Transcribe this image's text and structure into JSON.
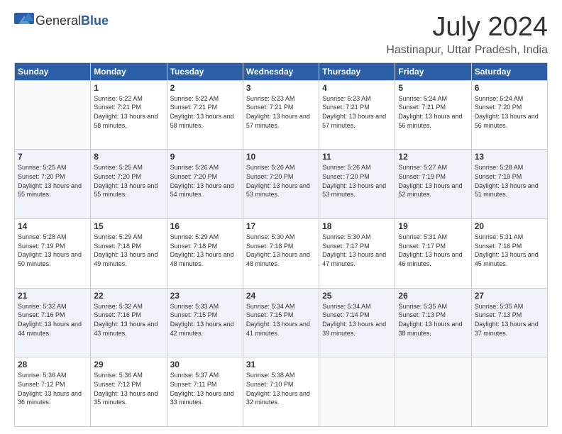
{
  "header": {
    "logo_general": "General",
    "logo_blue": "Blue",
    "title": "July 2024",
    "subtitle": "Hastinapur, Uttar Pradesh, India"
  },
  "calendar": {
    "days_of_week": [
      "Sunday",
      "Monday",
      "Tuesday",
      "Wednesday",
      "Thursday",
      "Friday",
      "Saturday"
    ],
    "weeks": [
      [
        {
          "day": "",
          "sunrise": "",
          "sunset": "",
          "daylight": "",
          "empty": true
        },
        {
          "day": "1",
          "sunrise": "Sunrise: 5:22 AM",
          "sunset": "Sunset: 7:21 PM",
          "daylight": "Daylight: 13 hours and 58 minutes."
        },
        {
          "day": "2",
          "sunrise": "Sunrise: 5:22 AM",
          "sunset": "Sunset: 7:21 PM",
          "daylight": "Daylight: 13 hours and 58 minutes."
        },
        {
          "day": "3",
          "sunrise": "Sunrise: 5:23 AM",
          "sunset": "Sunset: 7:21 PM",
          "daylight": "Daylight: 13 hours and 57 minutes."
        },
        {
          "day": "4",
          "sunrise": "Sunrise: 5:23 AM",
          "sunset": "Sunset: 7:21 PM",
          "daylight": "Daylight: 13 hours and 57 minutes."
        },
        {
          "day": "5",
          "sunrise": "Sunrise: 5:24 AM",
          "sunset": "Sunset: 7:21 PM",
          "daylight": "Daylight: 13 hours and 56 minutes."
        },
        {
          "day": "6",
          "sunrise": "Sunrise: 5:24 AM",
          "sunset": "Sunset: 7:20 PM",
          "daylight": "Daylight: 13 hours and 56 minutes."
        }
      ],
      [
        {
          "day": "7",
          "sunrise": "Sunrise: 5:25 AM",
          "sunset": "Sunset: 7:20 PM",
          "daylight": "Daylight: 13 hours and 55 minutes."
        },
        {
          "day": "8",
          "sunrise": "Sunrise: 5:25 AM",
          "sunset": "Sunset: 7:20 PM",
          "daylight": "Daylight: 13 hours and 55 minutes."
        },
        {
          "day": "9",
          "sunrise": "Sunrise: 5:26 AM",
          "sunset": "Sunset: 7:20 PM",
          "daylight": "Daylight: 13 hours and 54 minutes."
        },
        {
          "day": "10",
          "sunrise": "Sunrise: 5:26 AM",
          "sunset": "Sunset: 7:20 PM",
          "daylight": "Daylight: 13 hours and 53 minutes."
        },
        {
          "day": "11",
          "sunrise": "Sunrise: 5:26 AM",
          "sunset": "Sunset: 7:20 PM",
          "daylight": "Daylight: 13 hours and 53 minutes."
        },
        {
          "day": "12",
          "sunrise": "Sunrise: 5:27 AM",
          "sunset": "Sunset: 7:19 PM",
          "daylight": "Daylight: 13 hours and 52 minutes."
        },
        {
          "day": "13",
          "sunrise": "Sunrise: 5:28 AM",
          "sunset": "Sunset: 7:19 PM",
          "daylight": "Daylight: 13 hours and 51 minutes."
        }
      ],
      [
        {
          "day": "14",
          "sunrise": "Sunrise: 5:28 AM",
          "sunset": "Sunset: 7:19 PM",
          "daylight": "Daylight: 13 hours and 50 minutes."
        },
        {
          "day": "15",
          "sunrise": "Sunrise: 5:29 AM",
          "sunset": "Sunset: 7:18 PM",
          "daylight": "Daylight: 13 hours and 49 minutes."
        },
        {
          "day": "16",
          "sunrise": "Sunrise: 5:29 AM",
          "sunset": "Sunset: 7:18 PM",
          "daylight": "Daylight: 13 hours and 48 minutes."
        },
        {
          "day": "17",
          "sunrise": "Sunrise: 5:30 AM",
          "sunset": "Sunset: 7:18 PM",
          "daylight": "Daylight: 13 hours and 48 minutes."
        },
        {
          "day": "18",
          "sunrise": "Sunrise: 5:30 AM",
          "sunset": "Sunset: 7:17 PM",
          "daylight": "Daylight: 13 hours and 47 minutes."
        },
        {
          "day": "19",
          "sunrise": "Sunrise: 5:31 AM",
          "sunset": "Sunset: 7:17 PM",
          "daylight": "Daylight: 13 hours and 46 minutes."
        },
        {
          "day": "20",
          "sunrise": "Sunrise: 5:31 AM",
          "sunset": "Sunset: 7:16 PM",
          "daylight": "Daylight: 13 hours and 45 minutes."
        }
      ],
      [
        {
          "day": "21",
          "sunrise": "Sunrise: 5:32 AM",
          "sunset": "Sunset: 7:16 PM",
          "daylight": "Daylight: 13 hours and 44 minutes."
        },
        {
          "day": "22",
          "sunrise": "Sunrise: 5:32 AM",
          "sunset": "Sunset: 7:16 PM",
          "daylight": "Daylight: 13 hours and 43 minutes."
        },
        {
          "day": "23",
          "sunrise": "Sunrise: 5:33 AM",
          "sunset": "Sunset: 7:15 PM",
          "daylight": "Daylight: 13 hours and 42 minutes."
        },
        {
          "day": "24",
          "sunrise": "Sunrise: 5:34 AM",
          "sunset": "Sunset: 7:15 PM",
          "daylight": "Daylight: 13 hours and 41 minutes."
        },
        {
          "day": "25",
          "sunrise": "Sunrise: 5:34 AM",
          "sunset": "Sunset: 7:14 PM",
          "daylight": "Daylight: 13 hours and 39 minutes."
        },
        {
          "day": "26",
          "sunrise": "Sunrise: 5:35 AM",
          "sunset": "Sunset: 7:13 PM",
          "daylight": "Daylight: 13 hours and 38 minutes."
        },
        {
          "day": "27",
          "sunrise": "Sunrise: 5:35 AM",
          "sunset": "Sunset: 7:13 PM",
          "daylight": "Daylight: 13 hours and 37 minutes."
        }
      ],
      [
        {
          "day": "28",
          "sunrise": "Sunrise: 5:36 AM",
          "sunset": "Sunset: 7:12 PM",
          "daylight": "Daylight: 13 hours and 36 minutes."
        },
        {
          "day": "29",
          "sunrise": "Sunrise: 5:36 AM",
          "sunset": "Sunset: 7:12 PM",
          "daylight": "Daylight: 13 hours and 35 minutes."
        },
        {
          "day": "30",
          "sunrise": "Sunrise: 5:37 AM",
          "sunset": "Sunset: 7:11 PM",
          "daylight": "Daylight: 13 hours and 33 minutes."
        },
        {
          "day": "31",
          "sunrise": "Sunrise: 5:38 AM",
          "sunset": "Sunset: 7:10 PM",
          "daylight": "Daylight: 13 hours and 32 minutes."
        },
        {
          "day": "",
          "sunrise": "",
          "sunset": "",
          "daylight": "",
          "empty": true
        },
        {
          "day": "",
          "sunrise": "",
          "sunset": "",
          "daylight": "",
          "empty": true
        },
        {
          "day": "",
          "sunrise": "",
          "sunset": "",
          "daylight": "",
          "empty": true
        }
      ]
    ]
  }
}
